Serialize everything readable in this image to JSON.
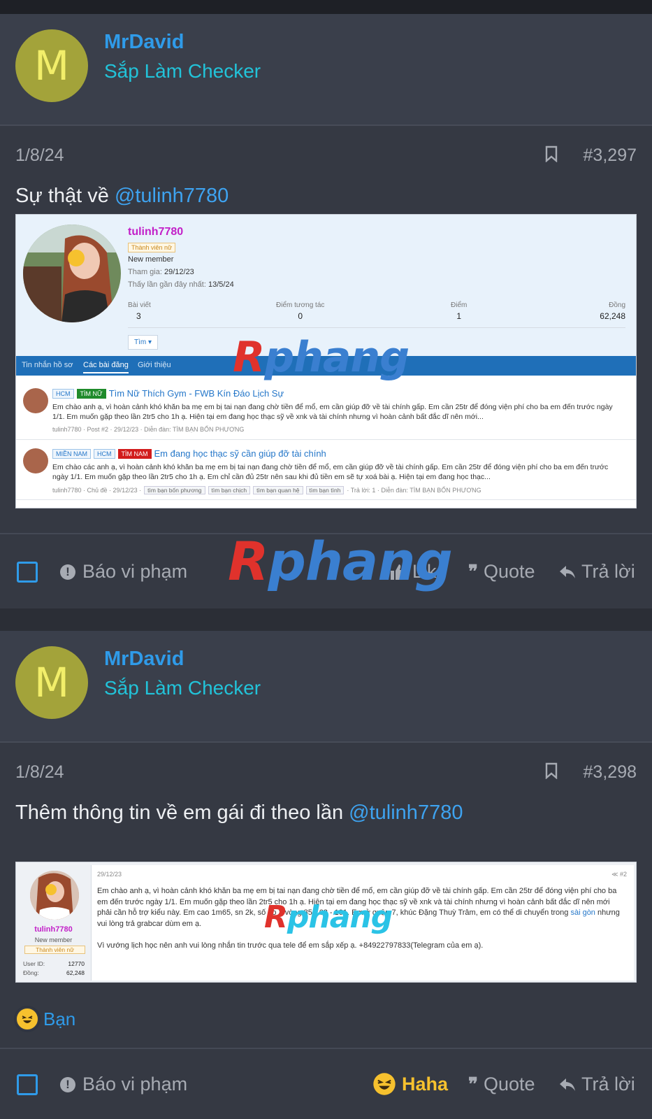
{
  "posts": [
    {
      "user": {
        "avatar_letter": "M",
        "name": "MrDavid",
        "title": "Sắp Làm Checker"
      },
      "date": "1/8/24",
      "post_number": "#3,297",
      "text_prefix": "Sự thật về ",
      "mention": "@tulinh7780"
    },
    {
      "user": {
        "avatar_letter": "M",
        "name": "MrDavid",
        "title": "Sắp Làm Checker"
      },
      "date": "1/8/24",
      "post_number": "#3,298",
      "text_prefix": "Thêm thông tin về em gái đi theo lần ",
      "mention": "@tulinh7780"
    }
  ],
  "footer": {
    "report_label": "Báo vi phạm",
    "like_label": "Like",
    "quote_label": "Quote",
    "reply_label": "Trả lời",
    "haha_label": "Haha"
  },
  "reaction": {
    "label": "Bạn"
  },
  "watermark": {
    "part1": "R",
    "part2": "phang"
  },
  "embed1": {
    "name": "tulinh7780",
    "badge": "Thành viên nữ",
    "role": "New member",
    "joined_key": "Tham gia:",
    "joined_val": "29/12/23",
    "seen_key": "Thấy lần gần đây nhất:",
    "seen_val": "13/5/24",
    "stats": [
      {
        "label": "Bài viết",
        "value": "3"
      },
      {
        "label": "Điểm tương tác",
        "value": "0"
      },
      {
        "label": "Điểm",
        "value": "1"
      },
      {
        "label": "Đồng",
        "value": "62,248"
      }
    ],
    "find_label": "Tìm ▾",
    "tabs": [
      "Tin nhắn hồ sơ",
      "Các bài đăng",
      "Giới thiệu"
    ],
    "rows": [
      {
        "tags": [
          "HCM",
          "TÌM NỮ"
        ],
        "title": "Tìm Nữ Thích Gym - FWB Kín Đáo Lịch Sự",
        "snippet": "Em chào anh ạ, vì hoàn cảnh khó khăn ba mẹ em bị tai nạn đang chờ tiền để mổ, em cần giúp đỡ về tài chính gấp. Em cần 25tr để đóng viện phí cho ba em đến trước ngày 1/1. Em muốn gặp theo lần 2tr5 cho 1h ạ. Hiện tại em đang học thạc sỹ về xnk và tài chính nhưng vì hoàn cảnh bất đắc dĩ nên mới...",
        "foot": "tulinh7780 · Post #2 · 29/12/23 · Diễn đàn: TÌM BẠN BỐN PHƯƠNG"
      },
      {
        "tags": [
          "MIỀN NAM",
          "HCM",
          "TÌM NAM"
        ],
        "title": "Em đang học thạc sỹ cần giúp đỡ tài chính",
        "snippet": "Em chào các anh ạ, vì hoàn cảnh khó khăn ba mẹ em bị tai nạn đang chờ tiền để mổ, em cần giúp đỡ về tài chính gấp. Em cần 25tr để đóng viện phí cho ba em đến trước ngày 1/1. Em muốn gặp theo lần 2tr5 cho 1h ạ. Em chỉ cần đủ 25tr nên sau khi đủ tiền em sẽ tự xoá bài ạ. Hiện tại em đang học thạc...",
        "foot_prefix": "tulinh7780 · Chủ đề · 29/12/23 ·",
        "chips": [
          "tìm bạn bốn phương",
          "tìm bạn chịch",
          "tìm bạn quan hệ",
          "tìm bạn tình"
        ],
        "foot_suffix": "· Trả lời: 1 · Diễn đàn: TÌM BẠN BỐN PHƯƠNG"
      }
    ]
  },
  "embed2": {
    "name": "tulinh7780",
    "role": "New member",
    "badge": "Thành viên nữ",
    "userid_key": "User ID:",
    "userid_val": "12770",
    "dong_key": "Đồng:",
    "dong_val": "62,248",
    "date": "29/12/23",
    "share": "≪  #2",
    "body1": "Em chào anh ạ, vì hoàn cảnh khó khăn ba mẹ em bị tai nạn đang chờ tiền để mổ, em cần giúp đỡ về tài chính gấp. Em cần 25tr để đóng viện phí cho ba em đến trước ngày 1/1. Em muốn gặp theo lần 2tr5 cho 1h ạ. Hiện tại em đang học thạc sỹ về xnk và tài chính nhưng vì hoàn cảnh bất đắc dĩ nên mới phải cần hỗ trợ kiểu này. Em cao 1m65, sn 2k, số đo 3 vòng 85 - 62 - 101. Em ở quận 7, khúc Đặng Thuỳ Trâm, em có thể di chuyển trong ",
    "body_link": "sài gòn",
    "body1_end": " nhưng vui lòng trả grabcar dùm em ạ.",
    "body2": "Vì vướng lịch học nên anh vui lòng nhắn tin trước qua tele để em sắp xếp ạ. +84922797833(Telegram của em ạ)."
  },
  "colors": {
    "accent": "#2f9be9",
    "title": "#22c3d9",
    "avatar_bg": "#a3a33a",
    "haha": "#f6c12e"
  }
}
